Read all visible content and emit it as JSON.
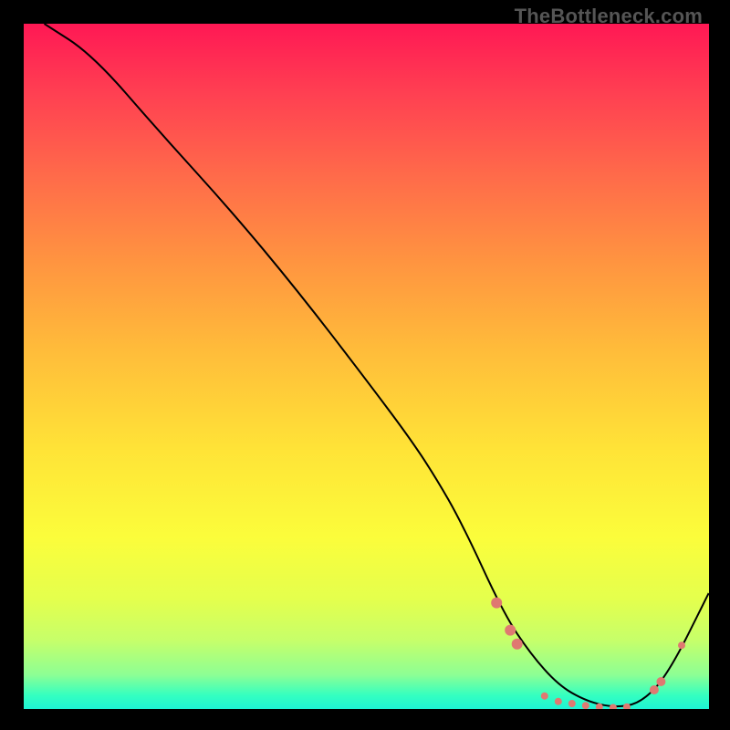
{
  "watermark": "TheBottleneck.com",
  "chart_data": {
    "type": "line",
    "title": "",
    "xlabel": "",
    "ylabel": "",
    "xlim": [
      0,
      100
    ],
    "ylim": [
      0,
      100
    ],
    "grid": false,
    "series": [
      {
        "name": "curve",
        "x": [
          3,
          10,
          20,
          30,
          40,
          50,
          56,
          60,
          64,
          70,
          74,
          78,
          82,
          86,
          90,
          94,
          100
        ],
        "y": [
          100,
          95.5,
          84,
          73,
          61,
          48,
          40,
          34,
          27,
          14,
          8,
          3.5,
          1.2,
          0.2,
          0.8,
          5,
          17
        ],
        "color": "#000000",
        "line_width": 2
      }
    ],
    "markers": [
      {
        "x": 69,
        "y": 15.5,
        "r": 6,
        "color": "#df7971"
      },
      {
        "x": 71,
        "y": 11.5,
        "r": 6,
        "color": "#df7971"
      },
      {
        "x": 72,
        "y": 9.5,
        "r": 6,
        "color": "#df7971"
      },
      {
        "x": 76,
        "y": 1.9,
        "r": 4,
        "color": "#df7971"
      },
      {
        "x": 78,
        "y": 1.1,
        "r": 4,
        "color": "#df7971"
      },
      {
        "x": 80,
        "y": 0.8,
        "r": 4,
        "color": "#df7971"
      },
      {
        "x": 82,
        "y": 0.5,
        "r": 4,
        "color": "#df7971"
      },
      {
        "x": 84,
        "y": 0.3,
        "r": 4,
        "color": "#df7971"
      },
      {
        "x": 86,
        "y": 0.2,
        "r": 4,
        "color": "#df7971"
      },
      {
        "x": 88,
        "y": 0.3,
        "r": 4,
        "color": "#df7971"
      },
      {
        "x": 92,
        "y": 2.8,
        "r": 5,
        "color": "#df7971"
      },
      {
        "x": 93,
        "y": 4.0,
        "r": 5,
        "color": "#df7971"
      },
      {
        "x": 96,
        "y": 9.3,
        "r": 4,
        "color": "#df7971"
      }
    ]
  }
}
